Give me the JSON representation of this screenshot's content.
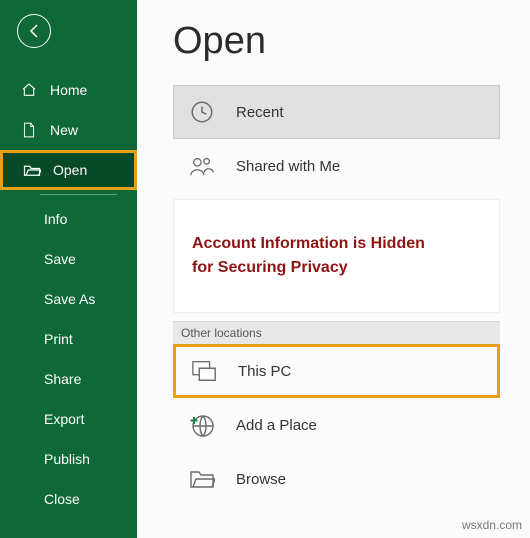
{
  "sidebar": {
    "items": [
      {
        "label": "Home"
      },
      {
        "label": "New"
      },
      {
        "label": "Open"
      }
    ],
    "sub_items": [
      {
        "label": "Info"
      },
      {
        "label": "Save"
      },
      {
        "label": "Save As"
      },
      {
        "label": "Print"
      },
      {
        "label": "Share"
      },
      {
        "label": "Export"
      },
      {
        "label": "Publish"
      },
      {
        "label": "Close"
      }
    ]
  },
  "main": {
    "title": "Open",
    "rows": {
      "recent": "Recent",
      "shared": "Shared with Me",
      "this_pc": "This PC",
      "add_place": "Add a Place",
      "browse": "Browse"
    },
    "section_other": "Other locations",
    "info_line1": "Account Information is Hidden",
    "info_line2": "for Securing Privacy"
  },
  "watermark": "wsxdn.com"
}
